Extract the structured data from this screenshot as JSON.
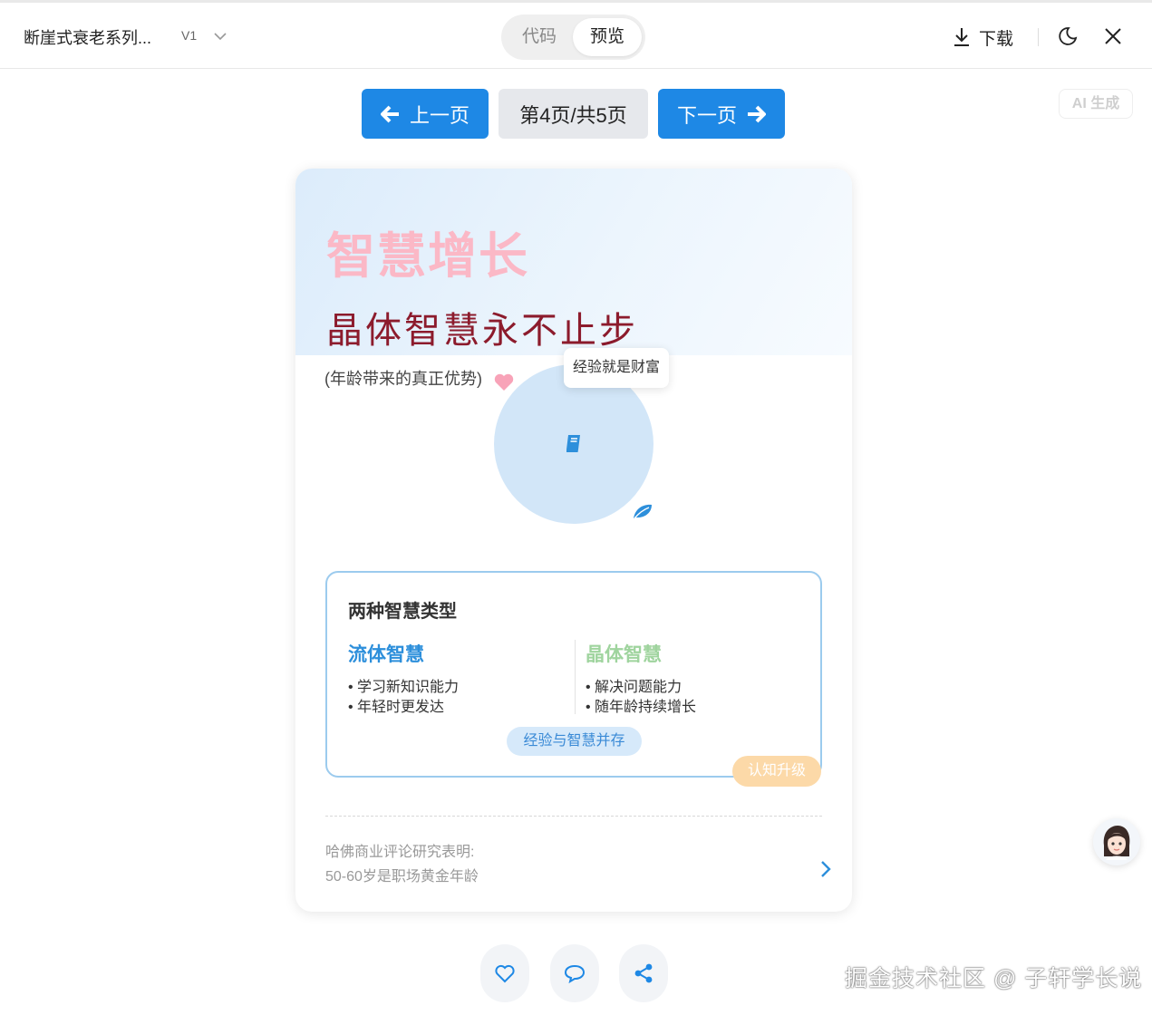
{
  "header": {
    "doc_title": "断崖式衰老系列...",
    "version": "V1",
    "tabs": {
      "code": "代码",
      "preview": "预览"
    },
    "download_label": "下载"
  },
  "pager": {
    "prev_label": "上一页",
    "page_indicator": "第4页/共5页",
    "next_label": "下一页",
    "current_page": 4,
    "total_pages": 5
  },
  "ai_badge": "AI 生成",
  "card": {
    "big_title": "智慧增长",
    "subtitle": "晶体智慧永不止步",
    "note": "(年龄带来的真正优势)",
    "tooltip": "经验就是财富",
    "panel": {
      "title": "两种智慧类型",
      "left": {
        "title": "流体智慧",
        "items": [
          "• 学习新知识能力",
          "• 年轻时更发达"
        ]
      },
      "right": {
        "title": "晶体智慧",
        "items": [
          "• 解决问题能力",
          "• 随年龄持续增长"
        ]
      },
      "coexist_tag": "经验与智慧并存",
      "upgrade_tag": "认知升级"
    },
    "source_line1": "哈佛商业评论研究表明:",
    "source_line2": "50-60岁是职场黄金年龄"
  },
  "icons": {
    "book": "book-icon",
    "heart": "heart-icon",
    "leaf": "leaf-icon"
  },
  "colors": {
    "accent": "#1e88e5",
    "title_pink": "#fbb8c6",
    "subtitle_red": "#8c1b2c",
    "fluid_blue": "#2d8fdb",
    "crystal_green": "#9fd49e"
  },
  "watermark": "掘金技术社区 @ 子轩学长说"
}
